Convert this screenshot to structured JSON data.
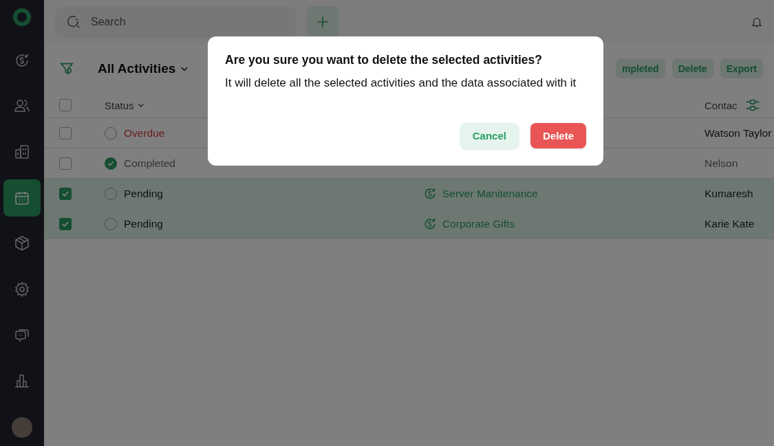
{
  "sidebar": {
    "items": [
      {
        "kind": "deals",
        "selected": false
      },
      {
        "kind": "contacts",
        "selected": false
      },
      {
        "kind": "companies",
        "selected": false
      },
      {
        "kind": "activities",
        "selected": true
      },
      {
        "kind": "products",
        "selected": false
      },
      {
        "kind": "settings",
        "selected": false
      },
      {
        "kind": "chat",
        "selected": false
      },
      {
        "kind": "reports",
        "selected": false
      }
    ]
  },
  "topbar": {
    "search": {
      "placeholder": "Search"
    }
  },
  "toolbar": {
    "view": "All Activities",
    "actions": [
      "mpleted",
      "Delete",
      "Export"
    ]
  },
  "table": {
    "select_all": {
      "checked": false
    },
    "columns": {
      "status": "Status",
      "contact": "Contac"
    },
    "rows": [
      {
        "checked": false,
        "status": {
          "kind": "overdue",
          "label": "Overdue"
        },
        "activity": "",
        "contact": "Watson Taylor"
      },
      {
        "checked": false,
        "status": {
          "kind": "completed",
          "label": "Completed"
        },
        "activity": "",
        "contact": "Nelson"
      },
      {
        "checked": true,
        "status": {
          "kind": "pending",
          "label": "Pending"
        },
        "activity": "Server Manitenance",
        "contact": "Kumaresh"
      },
      {
        "checked": true,
        "status": {
          "kind": "pending",
          "label": "Pending"
        },
        "activity": "Corporate Gifts",
        "contact": "Karie Kate"
      }
    ]
  },
  "dialog": {
    "title": "Are you sure you want to delete the selected activities?",
    "message": "It will delete all the selected activities and the data associated with it",
    "buttons": [
      {
        "kind": "cancel",
        "label": "Cancel"
      },
      {
        "kind": "danger",
        "label": "Delete"
      }
    ]
  }
}
